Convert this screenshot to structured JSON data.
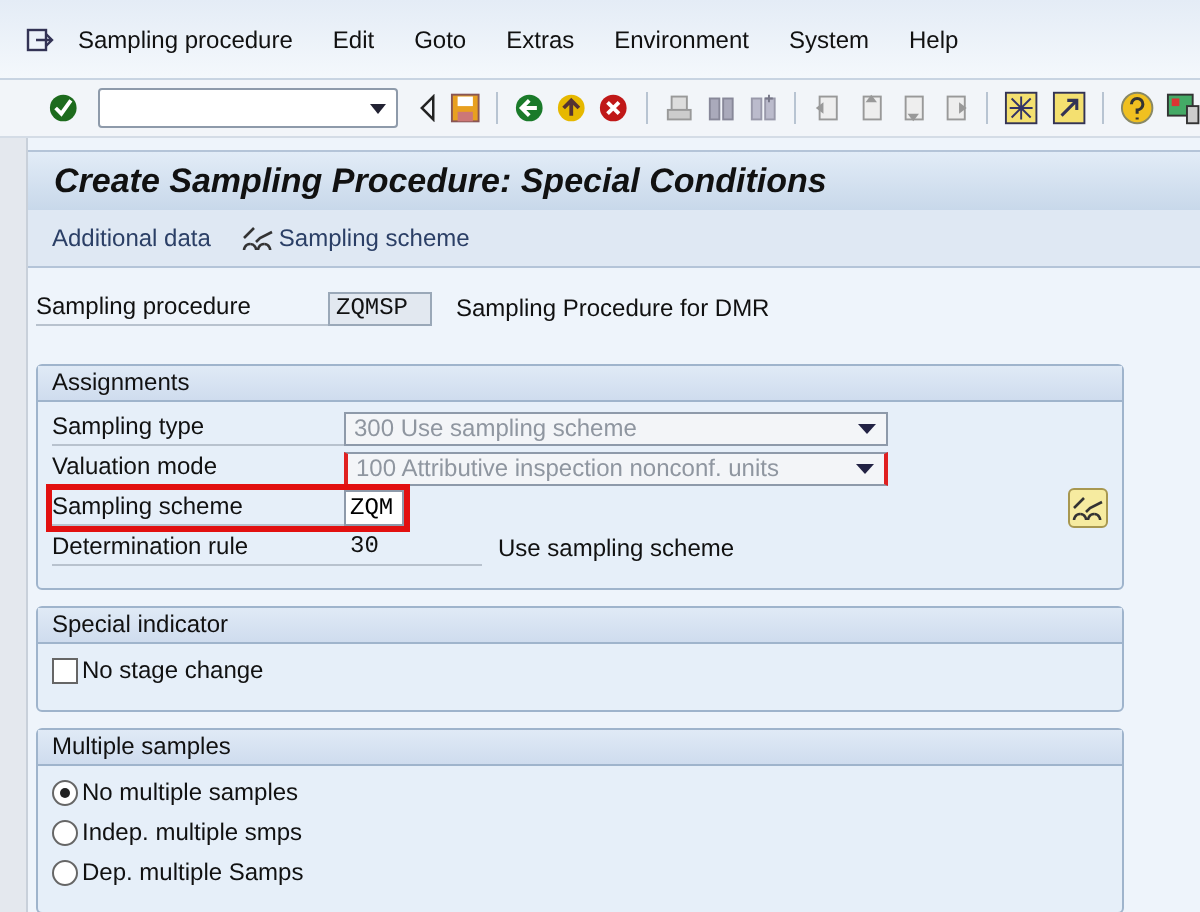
{
  "menu": [
    "Sampling procedure",
    "Edit",
    "Goto",
    "Extras",
    "Environment",
    "System",
    "Help"
  ],
  "title": "Create Sampling Procedure: Special Conditions",
  "app_toolbar": [
    {
      "label": "Additional data",
      "kind": "text"
    },
    {
      "label": "Sampling scheme",
      "kind": "glasses"
    }
  ],
  "header": {
    "label": "Sampling procedure",
    "value": "ZQMSP",
    "description": "Sampling Procedure for DMR"
  },
  "groups": [
    {
      "title": "Assignments",
      "rows": [
        {
          "kind": "dropdown",
          "label": "Sampling type",
          "value": "300 Use sampling scheme",
          "disabled": true,
          "required": false
        },
        {
          "kind": "dropdown",
          "label": "Valuation mode",
          "value": "100 Attributive inspection nonconf. units",
          "disabled": true,
          "required": true
        },
        {
          "kind": "input",
          "label": "Sampling scheme",
          "value": "ZQM",
          "highlighted": true,
          "display_button": true
        },
        {
          "kind": "output",
          "label": "Determination rule",
          "value": "30",
          "description": "Use sampling scheme"
        }
      ]
    },
    {
      "title": "Special indicator",
      "rows": [
        {
          "kind": "checkbox",
          "label": "No stage change",
          "checked": false
        }
      ]
    },
    {
      "title": "Multiple samples",
      "rows": [
        {
          "kind": "radio",
          "label": "No multiple samples",
          "selected": true
        },
        {
          "kind": "radio",
          "label": "Indep. multiple smps",
          "selected": false
        },
        {
          "kind": "radio",
          "label": "Dep. multiple Samps",
          "selected": false
        }
      ]
    }
  ]
}
